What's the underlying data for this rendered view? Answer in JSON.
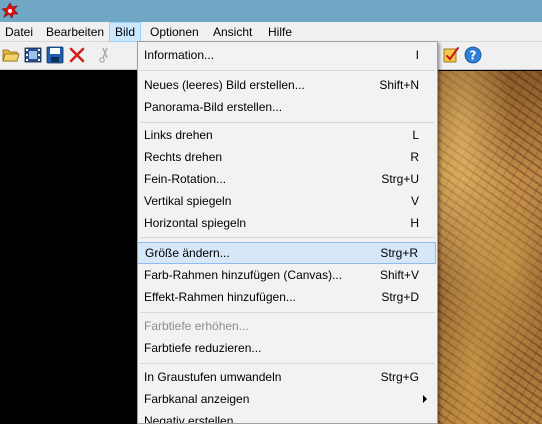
{
  "menubar": {
    "items": [
      {
        "label": "Datei"
      },
      {
        "label": "Bearbeiten"
      },
      {
        "label": "Bild"
      },
      {
        "label": "Optionen"
      },
      {
        "label": "Ansicht"
      },
      {
        "label": "Hilfe"
      }
    ]
  },
  "toolbar": {
    "buttons": [
      {
        "icon": "open-folder-icon"
      },
      {
        "icon": "filmstrip-icon"
      },
      {
        "icon": "save-disk-icon"
      },
      {
        "icon": "delete-x-icon"
      },
      {
        "icon": "edit-checklist-icon"
      },
      {
        "icon": "help-question-icon"
      }
    ]
  },
  "bild_menu": {
    "items": [
      {
        "label": "Information...",
        "shortcut": "I"
      },
      {
        "label": "Neues (leeres) Bild erstellen...",
        "shortcut": "Shift+N"
      },
      {
        "label": "Panorama-Bild erstellen...",
        "shortcut": ""
      },
      {
        "label": "Links drehen",
        "shortcut": "L"
      },
      {
        "label": "Rechts drehen",
        "shortcut": "R"
      },
      {
        "label": "Fein-Rotation...",
        "shortcut": "Strg+U"
      },
      {
        "label": "Vertikal spiegeln",
        "shortcut": "V"
      },
      {
        "label": "Horizontal spiegeln",
        "shortcut": "H"
      },
      {
        "label": "Größe ändern...",
        "shortcut": "Strg+R",
        "highlighted": true
      },
      {
        "label": "Farb-Rahmen hinzufügen (Canvas)...",
        "shortcut": "Shift+V"
      },
      {
        "label": "Effekt-Rahmen hinzufügen...",
        "shortcut": "Strg+D"
      },
      {
        "label": "Farbtiefe erhöhen...",
        "shortcut": "",
        "disabled": true
      },
      {
        "label": "Farbtiefe reduzieren...",
        "shortcut": ""
      },
      {
        "label": "In Graustufen umwandeln",
        "shortcut": "Strg+G"
      },
      {
        "label": "Farbkanal anzeigen",
        "shortcut": "",
        "submenu": true
      },
      {
        "label": "Negativ erstellen",
        "shortcut": ""
      }
    ]
  },
  "colors": {
    "titlebar": "#6fa7c4",
    "menu_active": "#cce8ff",
    "item_hover": "#d6e7f8",
    "disabled_text": "#8d8d8d"
  }
}
